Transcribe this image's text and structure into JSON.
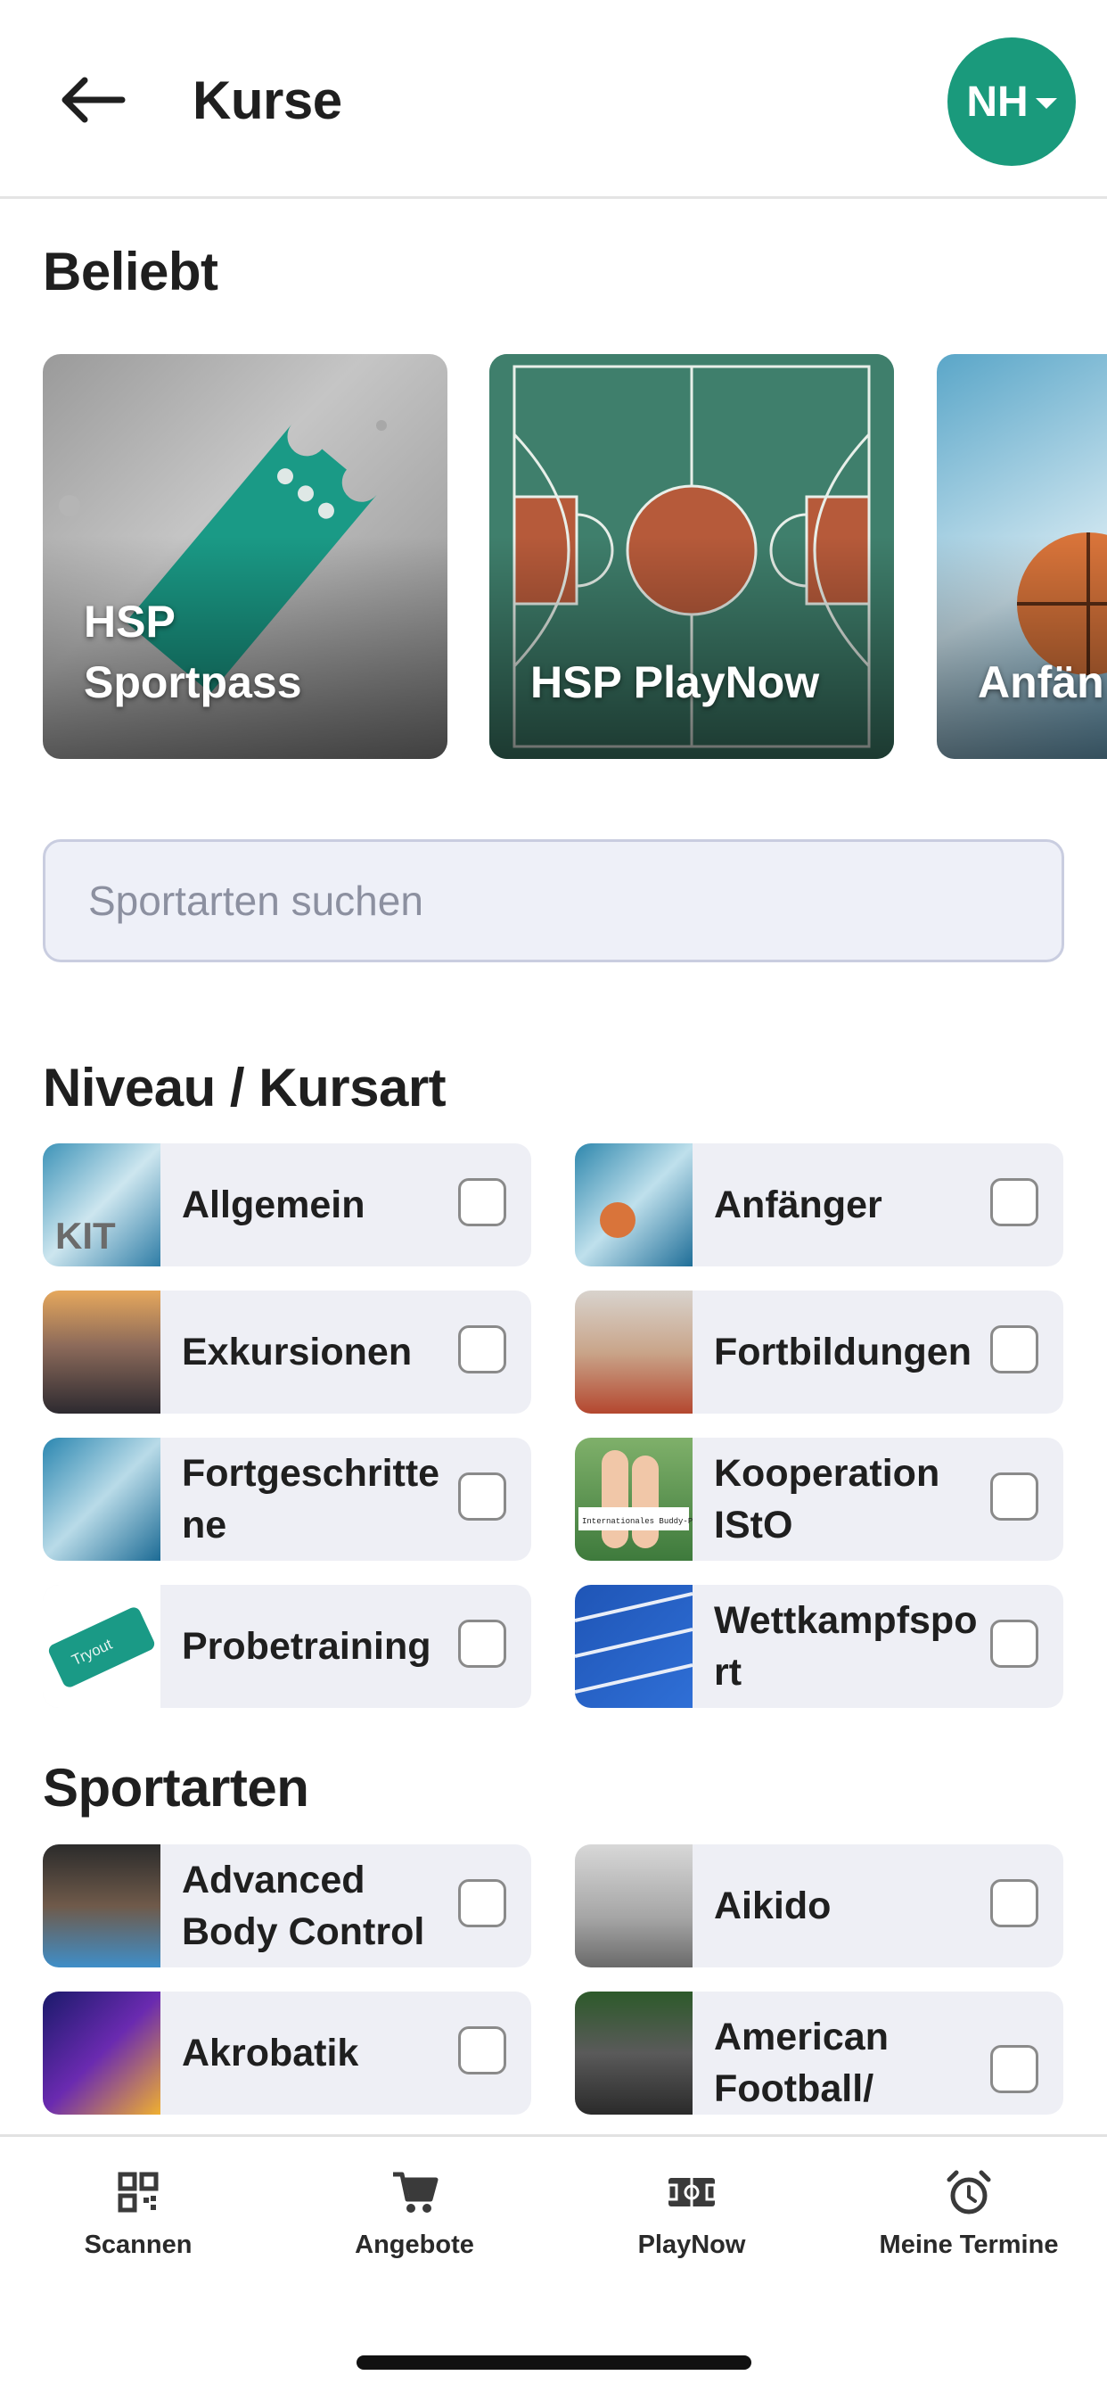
{
  "header": {
    "title": "Kurse",
    "avatar_initials": "NH"
  },
  "popular": {
    "title": "Beliebt",
    "cards": [
      {
        "label": "HSP Sportpass"
      },
      {
        "label": "HSP PlayNow"
      },
      {
        "label": "Anfän"
      }
    ]
  },
  "search": {
    "placeholder": "Sportarten suchen"
  },
  "level": {
    "title": "Niveau / Kursart",
    "items": [
      {
        "label": "Allgemein",
        "checked": false
      },
      {
        "label": "Anfänger",
        "checked": false
      },
      {
        "label": "Exkursionen",
        "checked": false
      },
      {
        "label": "Fortbildungen",
        "checked": false
      },
      {
        "label": "Fortgeschrittene",
        "checked": false
      },
      {
        "label": "Kooperation IStO",
        "checked": false
      },
      {
        "label": "Probetraining",
        "checked": false
      },
      {
        "label": "Wettkampfsport",
        "checked": false
      }
    ]
  },
  "sports": {
    "title": "Sportarten",
    "items": [
      {
        "label": "Advanced Body Control",
        "checked": false
      },
      {
        "label": "Aikido",
        "checked": false
      },
      {
        "label": "Akrobatik",
        "checked": false
      },
      {
        "label": "American Football/ Flagfootball",
        "checked": false
      }
    ]
  },
  "thumb_text": {
    "kit": "KIT",
    "buddy": "Internationales Buddy-Programm",
    "tryout": "Tryout"
  },
  "nav": {
    "items": [
      {
        "label": "Scannen",
        "icon": "qr-code-icon"
      },
      {
        "label": "Angebote",
        "icon": "cart-icon"
      },
      {
        "label": "PlayNow",
        "icon": "court-icon"
      },
      {
        "label": "Meine Termine",
        "icon": "alarm-clock-icon"
      }
    ]
  },
  "colors": {
    "accent": "#1a9a7c",
    "card_bg": "#eeeff5",
    "search_bg": "#eef0f8"
  }
}
